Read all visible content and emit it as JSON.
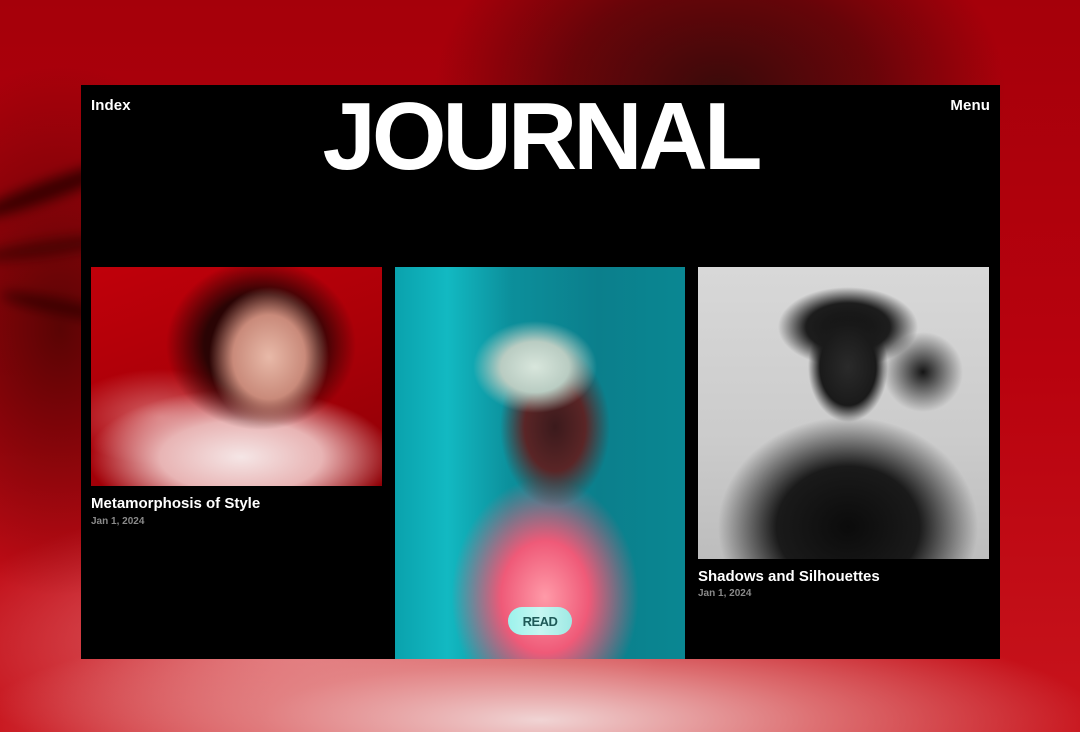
{
  "header": {
    "left_link": "Index",
    "title": "JOURNAL",
    "right_link": "Menu"
  },
  "articles": [
    {
      "title": "Metamorphosis of Style",
      "date": "Jan 1, 2024",
      "image": "red fashion portrait"
    },
    {
      "title": "",
      "date": "",
      "image": "teal side profile portrait",
      "cta_label": "READ"
    },
    {
      "title": "Shadows and Silhouettes",
      "date": "Jan 1, 2024",
      "image": "black-and-white profile portrait"
    }
  ],
  "colors": {
    "background": "#b0000c",
    "panel": "#000000",
    "text_primary": "#ffffff",
    "text_muted": "#8a8a8a",
    "cta": "#b8f4ef"
  }
}
